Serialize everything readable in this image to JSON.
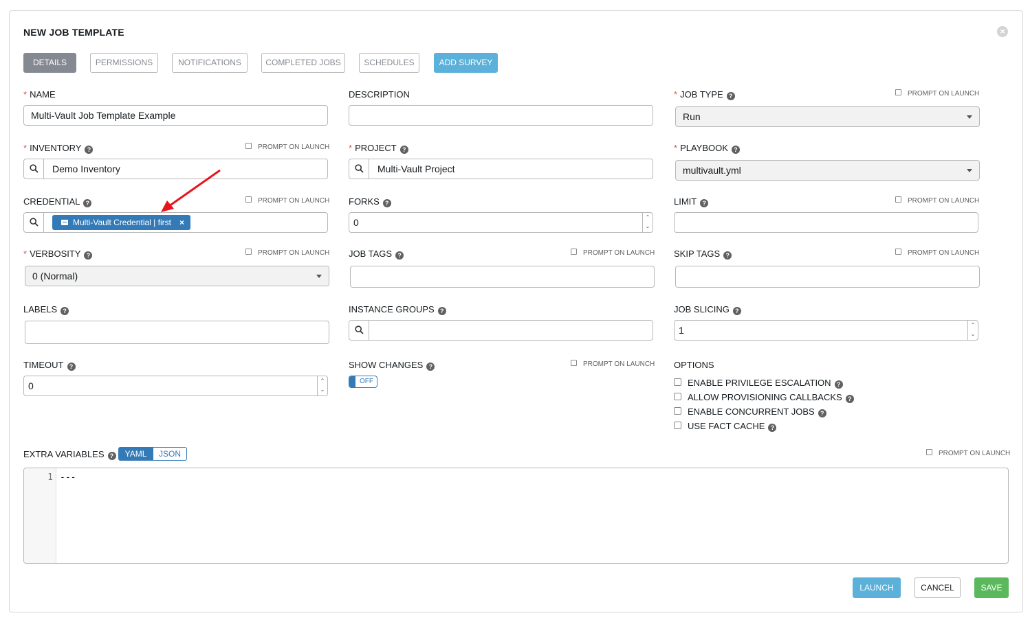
{
  "header": {
    "title": "NEW JOB TEMPLATE"
  },
  "tabs": {
    "details": "DETAILS",
    "permissions": "PERMISSIONS",
    "notifications": "NOTIFICATIONS",
    "completed_jobs": "COMPLETED JOBS",
    "schedules": "SCHEDULES",
    "add_survey": "ADD SURVEY"
  },
  "common": {
    "prompt_on_launch": "PROMPT ON LAUNCH",
    "required_mark": "*",
    "help_glyph": "?"
  },
  "fields": {
    "name": {
      "label": "NAME",
      "value": "Multi-Vault Job Template Example",
      "required": true
    },
    "description": {
      "label": "DESCRIPTION",
      "value": ""
    },
    "job_type": {
      "label": "JOB TYPE",
      "value": "Run",
      "required": true
    },
    "inventory": {
      "label": "INVENTORY",
      "value": "Demo Inventory",
      "required": true
    },
    "project": {
      "label": "PROJECT",
      "value": "Multi-Vault Project",
      "required": true
    },
    "playbook": {
      "label": "PLAYBOOK",
      "value": "multivault.yml",
      "required": true
    },
    "credential": {
      "label": "CREDENTIAL",
      "tag": "Multi-Vault Credential | first",
      "remove_glyph": "×"
    },
    "forks": {
      "label": "FORKS",
      "value": "0"
    },
    "limit": {
      "label": "LIMIT",
      "value": ""
    },
    "verbosity": {
      "label": "VERBOSITY",
      "value": "0 (Normal)",
      "required": true
    },
    "job_tags": {
      "label": "JOB TAGS",
      "value": ""
    },
    "skip_tags": {
      "label": "SKIP TAGS",
      "value": ""
    },
    "labels": {
      "label": "LABELS",
      "value": ""
    },
    "instance_groups": {
      "label": "INSTANCE GROUPS",
      "value": ""
    },
    "job_slicing": {
      "label": "JOB SLICING",
      "value": "1"
    },
    "timeout": {
      "label": "TIMEOUT",
      "value": "0"
    },
    "show_changes": {
      "label": "SHOW CHANGES",
      "toggle": "OFF"
    }
  },
  "options": {
    "label": "OPTIONS",
    "items": [
      {
        "label": "ENABLE PRIVILEGE ESCALATION",
        "checked": false
      },
      {
        "label": "ALLOW PROVISIONING CALLBACKS",
        "checked": false
      },
      {
        "label": "ENABLE CONCURRENT JOBS",
        "checked": false
      },
      {
        "label": "USE FACT CACHE",
        "checked": false
      }
    ]
  },
  "extra_vars": {
    "label": "EXTRA VARIABLES",
    "formats": [
      "YAML",
      "JSON"
    ],
    "active_format": "YAML",
    "line_number": "1",
    "code": "---"
  },
  "actions": {
    "launch": "LAUNCH",
    "cancel": "CANCEL",
    "save": "SAVE"
  },
  "colors": {
    "accent": "#337ab7",
    "survey": "#5bb1d9",
    "save": "#5cb85c",
    "required": "#d9534f",
    "tab_active": "#848992",
    "annotation_arrow": "#e8141b"
  },
  "icons": {
    "search": "search-icon",
    "close": "close-icon",
    "caret": "caret-down-icon",
    "help": "help-icon",
    "credential": "credential-box-icon"
  }
}
